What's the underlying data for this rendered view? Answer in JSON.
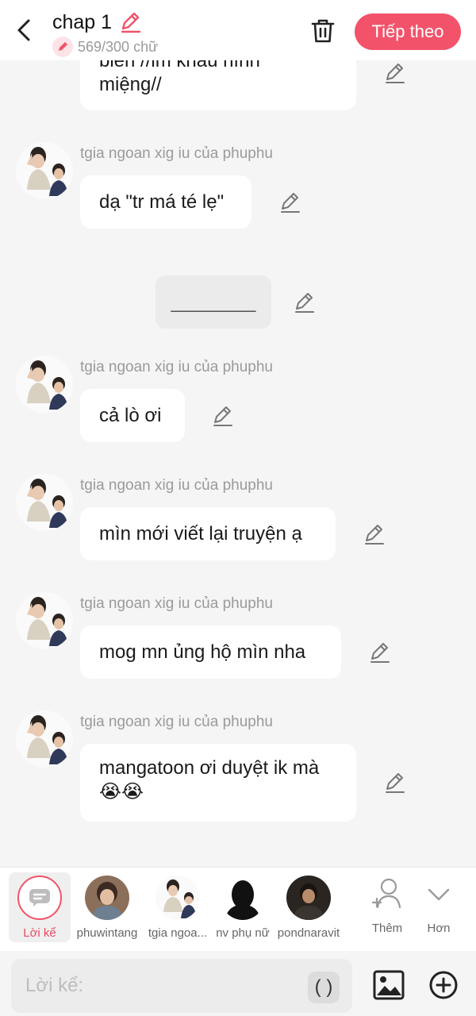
{
  "header": {
    "title": "chap 1",
    "word_count": "569/300 chữ",
    "next_label": "Tiếp theo"
  },
  "messages": [
    {
      "type": "bubble",
      "text": "miệng//",
      "partial_top": "biến //im khẩu hình"
    },
    {
      "type": "character",
      "author": "tgia ngoan xig iu của phuphu",
      "text": "dạ \"tr má té lẹ\""
    },
    {
      "type": "narration",
      "text": "________"
    },
    {
      "type": "character",
      "author": "tgia ngoan xig iu của phuphu",
      "text": "cả lò ơi"
    },
    {
      "type": "character",
      "author": "tgia ngoan xig iu của phuphu",
      "text": "mìn mới viết lại truyện ạ"
    },
    {
      "type": "character",
      "author": "tgia ngoan xig iu của phuphu",
      "text": "mog mn ủng hộ mìn nha"
    },
    {
      "type": "character",
      "author": "tgia ngoan xig iu của phuphu",
      "text_line1": "mangatoon ơi duyệt ik mà",
      "text_line2": "😭😭"
    }
  ],
  "character_bar": {
    "narration_label": "Lời kể",
    "characters": [
      {
        "name": "phuwintang"
      },
      {
        "name": "tgia ngoa..."
      },
      {
        "name": "nv phụ nữ"
      },
      {
        "name": "pondnaravit"
      }
    ],
    "more_label": "Thêm",
    "expand_label": "Hơn"
  },
  "input": {
    "placeholder": "Lời kể:",
    "paren_label": "( )"
  },
  "colors": {
    "accent": "#f2536a",
    "background": "#f5f5f5",
    "bubble": "#ffffff",
    "muted_text": "#9a9a9a"
  },
  "icons": [
    "back-arrow-icon",
    "pencil-icon",
    "trash-icon",
    "narration-icon",
    "add-character-icon",
    "chevron-down-icon",
    "image-icon",
    "plus-circle-icon"
  ]
}
